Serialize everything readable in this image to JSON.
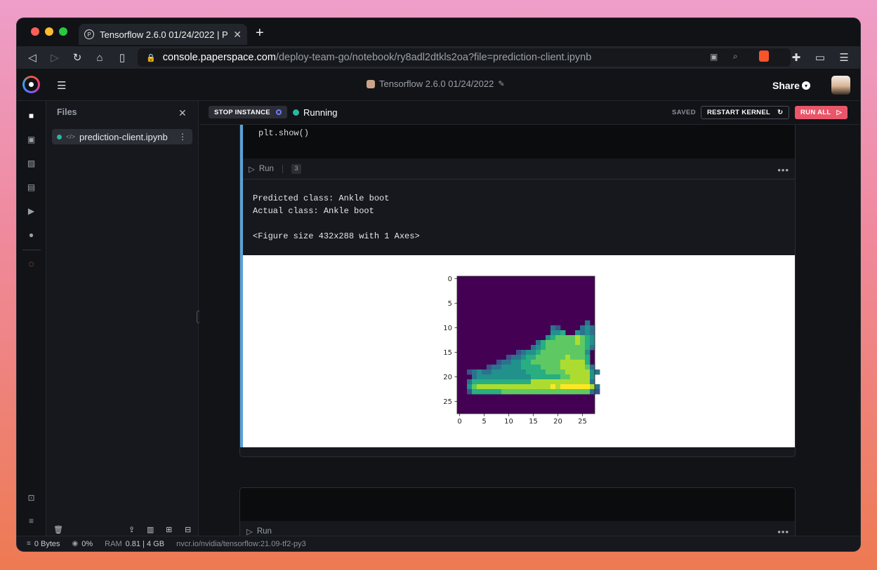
{
  "browser": {
    "tab_title": "Tensorflow 2.6.0 01/24/2022 | P",
    "url_host": "console.paperspace.com",
    "url_path": "/deploy-team-go/notebook/ry8adl2dtkls2oa?file=prediction-client.ipynb"
  },
  "header": {
    "notebook_title": "Tensorflow 2.6.0 01/24/2022",
    "share_label": "Share"
  },
  "files_panel": {
    "title": "Files",
    "items": [
      {
        "name": "prediction-client.ipynb"
      }
    ]
  },
  "toolbar": {
    "stop_label": "STOP INSTANCE",
    "status_label": "Running",
    "saved_label": "SAVED",
    "restart_label": "RESTART KERNEL",
    "run_all_label": "RUN ALL"
  },
  "cells": [
    {
      "code": "plt.show()",
      "run_label": "Run",
      "exec_count": "3",
      "output_lines": [
        "Predicted class: Ankle boot",
        "Actual class: Ankle boot",
        "",
        "<Figure size 432x288 with 1 Axes>"
      ]
    },
    {
      "code": "",
      "run_label": "Run"
    }
  ],
  "chart_data": {
    "type": "heatmap",
    "title": "",
    "x_ticks": [
      "0",
      "5",
      "10",
      "15",
      "20",
      "25"
    ],
    "y_ticks": [
      "0",
      "5",
      "10",
      "15",
      "20",
      "25"
    ],
    "xlim": [
      -0.5,
      27.5
    ],
    "ylim": [
      27.5,
      -0.5
    ],
    "colormap": "viridis",
    "grid": false,
    "image_rows": [
      "............................",
      "............................",
      "............................",
      "............................",
      "............................",
      "............................",
      "............................",
      "............................",
      "............................",
      "..........................2.",
      "...................21....232.",
      "...................334..3232.",
      "..................3455556543.",
      "................245555556543.",
      "...............2345555555542.",
      "............123345555555553..",
      "..........12234455555565554..",
      "........1223344555555666664..",
      "......1223333444455556666652.",
      "..123223333333444455556666632",
      "...2333333333334444445566663.",
      "..24444444444446666666666662.",
      "..356666666666666667677777762",
      "..144444455555555555555555521",
      "............................",
      "............................",
      "............................",
      "............................"
    ],
    "colors": {
      "0": "#440154",
      "1": "#3b528b",
      "2": "#2c728e",
      "3": "#21918c",
      "4": "#28ae80",
      "5": "#5ec962",
      "6": "#addc30",
      "7": "#fde725"
    }
  },
  "status_bar": {
    "storage": "0 Bytes",
    "cpu": "0%",
    "ram_label": "RAM",
    "ram_value": "0.81 | 4 GB",
    "container": "nvcr.io/nvidia/tensorflow:21.09-tf2-py3"
  },
  "colors": {
    "accent_run_all": "#e9566a",
    "status_running": "#2bb6a0",
    "cell_active_bar": "#5aa2d6"
  }
}
